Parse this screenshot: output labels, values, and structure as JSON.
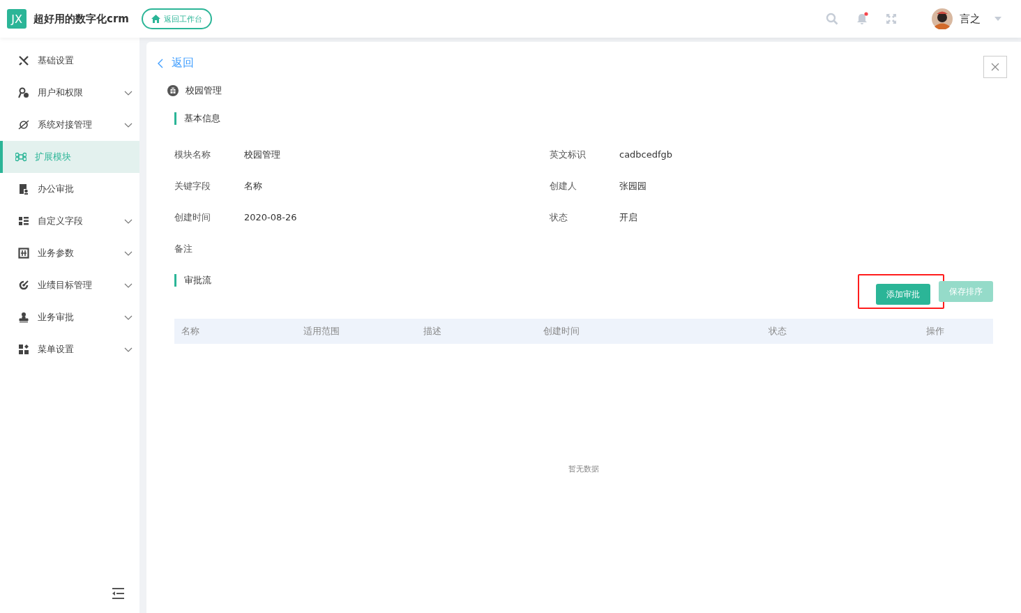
{
  "header": {
    "logo": "JX",
    "app_name": "超好用的数字化crm",
    "workbench_button": "返回工作台",
    "notification_dot": true,
    "user_name": "言之"
  },
  "sidebar": {
    "items": [
      {
        "label": "基础设置",
        "kind": "tools",
        "expandable": false,
        "selected": false
      },
      {
        "label": "用户和权限",
        "kind": "user-key",
        "expandable": true,
        "selected": false
      },
      {
        "label": "系统对接管理",
        "kind": "link",
        "expandable": true,
        "selected": false
      },
      {
        "label": "扩展模块",
        "kind": "command",
        "expandable": false,
        "selected": true
      },
      {
        "label": "办公审批",
        "kind": "doc",
        "expandable": false,
        "selected": false
      },
      {
        "label": "自定义字段",
        "kind": "list",
        "expandable": true,
        "selected": false
      },
      {
        "label": "业务参数",
        "kind": "grid",
        "expandable": true,
        "selected": false
      },
      {
        "label": "业绩目标管理",
        "kind": "target",
        "expandable": true,
        "selected": false
      },
      {
        "label": "业务审批",
        "kind": "stamp",
        "expandable": true,
        "selected": false
      },
      {
        "label": "菜单设置",
        "kind": "blocks",
        "expandable": true,
        "selected": false
      }
    ]
  },
  "detail": {
    "back": "返回",
    "module_title": "校园管理",
    "basic_section": "基本信息",
    "fields": [
      {
        "label": "模块名称",
        "value": "校园管理"
      },
      {
        "label": "英文标识",
        "value": "cadbcedfgb"
      },
      {
        "label": "关键字段",
        "value": "名称"
      },
      {
        "label": "创建人",
        "value": "张园园"
      },
      {
        "label": "创建时间",
        "value": "2020-08-26"
      },
      {
        "label": "状态",
        "value": "开启"
      },
      {
        "label": "备注"
      }
    ],
    "flow_section": "审批流",
    "buttons": [
      {
        "label": "添加审批",
        "disabled": false,
        "highlighted": true
      },
      {
        "label": "保存排序",
        "disabled": true,
        "highlighted": false
      }
    ],
    "table": {
      "columns": [
        "名称",
        "适用范围",
        "描述",
        "创建时间",
        "状态",
        "操作"
      ],
      "empty_text": "暂无数据"
    }
  }
}
